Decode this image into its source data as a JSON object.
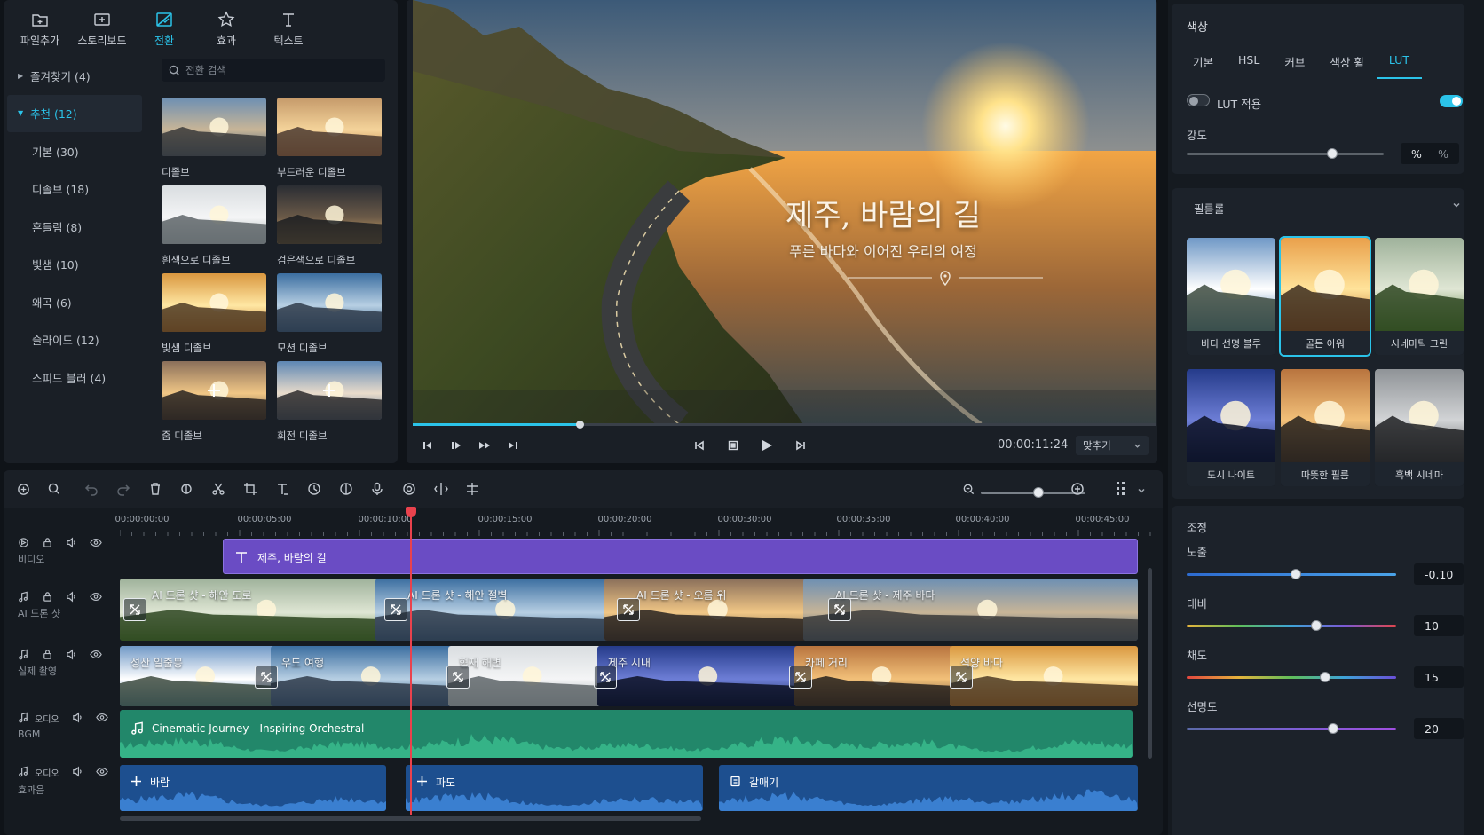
{
  "left_panel": {
    "tabs": [
      {
        "label": "파일추가",
        "icon": "folder-plus-icon",
        "active": false
      },
      {
        "label": "스토리보드",
        "icon": "storyboard-icon",
        "active": false
      },
      {
        "label": "전환",
        "icon": "transition-icon",
        "active": true
      },
      {
        "label": "효과",
        "icon": "star-icon",
        "active": false
      },
      {
        "label": "텍스트",
        "icon": "text-icon",
        "active": false
      }
    ],
    "categories": [
      {
        "label": "즐겨찾기 (4)",
        "expandable": true,
        "active": false
      },
      {
        "label": "추천 (12)",
        "expandable": true,
        "active": true
      },
      {
        "label": "기본 (30)"
      },
      {
        "label": "디졸브 (18)"
      },
      {
        "label": "흔들림 (8)"
      },
      {
        "label": "빛샘 (10)"
      },
      {
        "label": "왜곡 (6)"
      },
      {
        "label": "슬라이드 (12)"
      },
      {
        "label": "스피드 블러 (4)"
      }
    ],
    "search_placeholder": "전환 검색",
    "transitions": [
      {
        "label": "디졸브",
        "thumb": "ocean-sunset"
      },
      {
        "label": "부드러운 디졸브",
        "thumb": "warm-coast"
      },
      {
        "label": "흰색으로 디졸브",
        "thumb": "white-fade"
      },
      {
        "label": "검은색으로 디졸브",
        "thumb": "dark-fade"
      },
      {
        "label": "빛샘 디졸브",
        "thumb": "golden"
      },
      {
        "label": "모션 디졸브",
        "thumb": "blue-coast"
      },
      {
        "label": "줌 디졸브",
        "thumb": "road-zoom"
      },
      {
        "label": "회전 디졸브",
        "thumb": "road-spin"
      }
    ]
  },
  "preview": {
    "title": "제주, 바람의 길",
    "subtitle": "푸른 바다와 이어진 우리의 여정",
    "progress": 0.224,
    "timecode": "00:00:11:24",
    "fit_label": "맞추기"
  },
  "color_panel": {
    "title": "색상",
    "tabs": [
      "기본",
      "HSL",
      "커브",
      "색상 휠",
      "LUT"
    ],
    "active_tab": "LUT",
    "lut_label": "LUT 적용",
    "lut_on": true,
    "strength_label": "강도",
    "strength_value": "%",
    "strength_level": 0.74,
    "filmroll_title": "필름롤",
    "filters": [
      {
        "label": "바다 선명 블루",
        "thumb": "blue-cliff",
        "selected": false
      },
      {
        "label": "골든 아워",
        "thumb": "golden-hour",
        "selected": true
      },
      {
        "label": "시네마틱 그린",
        "thumb": "green-hills",
        "selected": false
      },
      {
        "label": "도시 나이트",
        "thumb": "night-city",
        "selected": false
      },
      {
        "label": "따뜻한 필름",
        "thumb": "warm-city",
        "selected": false
      },
      {
        "label": "흑백 시네마",
        "thumb": "bw-city",
        "selected": false
      }
    ],
    "adjust_title": "조정",
    "adjustments": [
      {
        "label": "노출",
        "value": "-0.10",
        "level": 0.52,
        "gradient": "blue"
      },
      {
        "label": "대비",
        "value": "10",
        "level": 0.62,
        "gradient": "rainbow"
      },
      {
        "label": "채도",
        "value": "15",
        "level": 0.66,
        "gradient": "rainbow2"
      },
      {
        "label": "선명도",
        "value": "20",
        "level": 0.7,
        "gradient": "purple"
      }
    ]
  },
  "timeline": {
    "ruler": [
      "00:00:00:00",
      "00:00:05:00",
      "00:00:10:00",
      "00:00:15:00",
      "00:00:20:00",
      "00:00:30:00",
      "00:00:35:00",
      "00:00:40:00",
      "00:00:45:00"
    ],
    "tracks": [
      {
        "label": "비디오",
        "kind": "video"
      },
      {
        "label": "AI 드론 샷",
        "kind": "music"
      },
      {
        "label": "실제 촬영",
        "kind": "music"
      },
      {
        "label": "BGM",
        "kind": "audio",
        "name": "오디오"
      },
      {
        "label": "효과음",
        "kind": "audio",
        "name": "오디오"
      }
    ],
    "title_clip": "제주, 바람의 길",
    "drone_clips": [
      "AI 드론 샷 - 해안 도로",
      "AI 드론 샷 - 해안 절벽",
      "AI 드론 샷 - 오름 위",
      "AI 드론 샷 - 제주 바다"
    ],
    "real_clips": [
      "성산 일출봉",
      "우도 여행",
      "협재 해변",
      "제주 시내",
      "카페 거리",
      "석양 바다"
    ],
    "bgm_clip": "Cinematic Journey - Inspiring Orchestral",
    "sfx_clips": [
      "바람",
      "파도",
      "갈매기"
    ],
    "zoom_level": 0.55
  }
}
